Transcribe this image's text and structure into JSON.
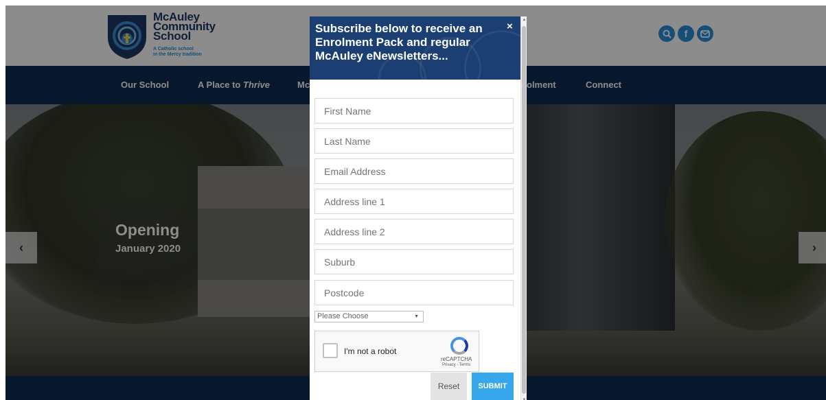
{
  "header": {
    "logo_lines": [
      "McAuley",
      "Community",
      "School"
    ],
    "logo_tagline_1": "A Catholic school",
    "logo_tagline_2": "in the Mercy tradition",
    "icons": [
      "search-icon",
      "facebook-icon",
      "mail-icon"
    ]
  },
  "nav": {
    "items": [
      {
        "label": "Our School"
      },
      {
        "label": "A Place to",
        "label_em": "Thrive"
      },
      {
        "label": "Mc"
      },
      {
        "label": "olment"
      },
      {
        "label": "Connect"
      }
    ]
  },
  "hero": {
    "title": "Opening",
    "subtitle": "January 2020",
    "prev_symbol": "‹",
    "next_symbol": "›"
  },
  "modal": {
    "title": "Subscribe below to receive an Enrolment Pack and regular McAuley eNewsletters...",
    "close_symbol": "×",
    "fields": [
      {
        "placeholder": "First Name"
      },
      {
        "placeholder": "Last Name"
      },
      {
        "placeholder": "Email Address"
      },
      {
        "placeholder": "Address line 1"
      },
      {
        "placeholder": "Address line 2"
      },
      {
        "placeholder": "Suburb"
      },
      {
        "placeholder": "Postcode"
      }
    ],
    "select_value": "Please Choose",
    "captcha": {
      "label": "I'm not a robot",
      "brand": "reCAPTCHA",
      "terms": "Privacy - Terms"
    },
    "reset_label": "Reset",
    "submit_label": "SUBMIT"
  },
  "colors": {
    "navy": "#0d2d52",
    "modal_header": "#1b3f72",
    "accent_blue": "#2b8fd9",
    "submit_blue": "#36a7ea"
  }
}
